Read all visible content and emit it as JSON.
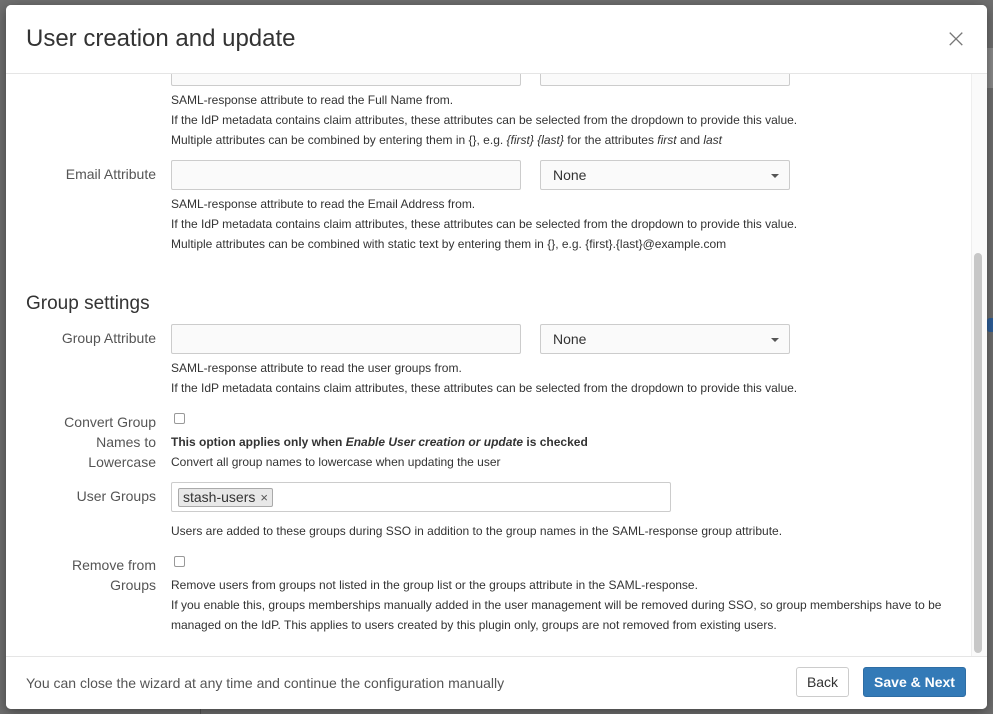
{
  "modal": {
    "title": "User creation and update"
  },
  "fullname": {
    "help1": "SAML-response attribute to read the Full Name from.",
    "help2": "If the IdP metadata contains claim attributes, these attributes can be selected from the dropdown to provide this value.",
    "help3_pre": "Multiple attributes can be combined by entering them in {}, e.g. ",
    "help3_code": "{first} {last}",
    "help3_mid": " for the attributes ",
    "help3_first": "first",
    "help3_and": " and ",
    "help3_last": "last"
  },
  "email": {
    "label": "Email Attribute",
    "value": "",
    "select_value": "None",
    "help1": "SAML-response attribute to read the Email Address from.",
    "help2": "If the IdP metadata contains claim attributes, these attributes can be selected from the dropdown to provide this value.",
    "help3": "Multiple attributes can be combined with static text by entering them in {}, e.g. {first}.{last}@example.com"
  },
  "group_settings": {
    "title": "Group settings",
    "group_attr_label": "Group Attribute",
    "group_attr_value": "",
    "group_attr_select": "None",
    "group_attr_help1": "SAML-response attribute to read the user groups from.",
    "group_attr_help2": "If the IdP metadata contains claim attributes, these attributes can be selected from the dropdown to provide this value.",
    "convert_label_1": "Convert Group",
    "convert_label_2": "Names to",
    "convert_label_3": "Lowercase",
    "convert_note_pre": "This option applies only when ",
    "convert_note_em": "Enable User creation or update",
    "convert_note_post": " is checked",
    "convert_help": "Convert all group names to lowercase when updating the user",
    "user_groups_label": "User Groups",
    "user_groups_tags": [
      "stash-users"
    ],
    "user_groups_help": "Users are added to these groups during SSO in addition to the group names in the SAML-response group attribute.",
    "remove_label_1": "Remove from",
    "remove_label_2": "Groups",
    "remove_help1": "Remove users from groups not listed in the group list or the groups attribute in the SAML-response.",
    "remove_help2": "If you enable this, groups memberships manually added in the user management will be removed during SSO, so group memberships have to be",
    "remove_help3": "managed on the IdP. This applies to users created by this plugin only, groups are not removed from existing users."
  },
  "footer": {
    "text": "You can close the wizard at any time and continue the configuration manually",
    "back_label": "Back",
    "next_label": "Save & Next"
  },
  "colors": {
    "primary": "#337ab7",
    "backdrop": "#6f6f6f"
  }
}
